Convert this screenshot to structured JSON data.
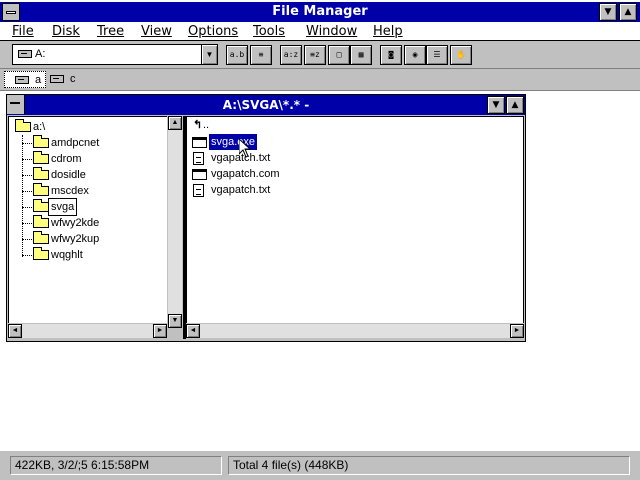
{
  "app": {
    "title": "File Manager"
  },
  "menu": [
    {
      "label": "File",
      "name": "file"
    },
    {
      "label": "Disk",
      "name": "disk"
    },
    {
      "label": "Tree",
      "name": "tree"
    },
    {
      "label": "View",
      "name": "view"
    },
    {
      "label": "Options",
      "name": "options"
    },
    {
      "label": "Tools",
      "name": "tools"
    },
    {
      "label": "Window",
      "name": "window"
    },
    {
      "label": "Help",
      "name": "help"
    }
  ],
  "toolbar": {
    "drive_value": "A:",
    "tools": [
      {
        "name": "view-name-tool",
        "glyph": "a.b"
      },
      {
        "name": "view-details-tool",
        "glyph": "≡"
      },
      {
        "name": "sort-name-tool",
        "glyph": "a:z"
      },
      {
        "name": "sort-type-tool",
        "glyph": "≡z"
      },
      {
        "name": "sort-size-tool",
        "glyph": "□"
      },
      {
        "name": "sort-date-tool",
        "glyph": "▦"
      },
      {
        "name": "connect-drive-tool",
        "glyph": "◙"
      },
      {
        "name": "disconnect-drive-tool",
        "glyph": "◉"
      },
      {
        "name": "share-tool",
        "glyph": "☰"
      },
      {
        "name": "stop-share-tool",
        "glyph": "✋"
      }
    ]
  },
  "drives": [
    {
      "letter": "a",
      "selected": true
    },
    {
      "letter": "c",
      "selected": false
    }
  ],
  "window": {
    "title": "A:\\SVGA\\*.* -"
  },
  "tree": {
    "root": "a:\\",
    "folders": [
      "amdpcnet",
      "cdrom",
      "dosidle",
      "mscdex",
      "svga",
      "wfwy2kde",
      "wfwy2kup",
      "wqghlt"
    ],
    "open_folder": "svga"
  },
  "files": {
    "up_label": "..",
    "items": [
      {
        "name": "svga.exe",
        "type": "exe",
        "selected": true
      },
      {
        "name": "vgapatch.txt",
        "type": "txt",
        "selected": false
      },
      {
        "name": "vgapatch.com",
        "type": "exe",
        "selected": false
      },
      {
        "name": "vgapatch.txt",
        "type": "txt",
        "selected": false
      }
    ]
  },
  "status": {
    "left": "422KB, 3/2/;5 6:15:58PM",
    "right": "Total 4 file(s) (448KB)"
  },
  "colors": {
    "titlebar": "#0000a8",
    "chrome": "#c0c0c0",
    "selection": "#0000a8",
    "folder": "#ffff80"
  }
}
